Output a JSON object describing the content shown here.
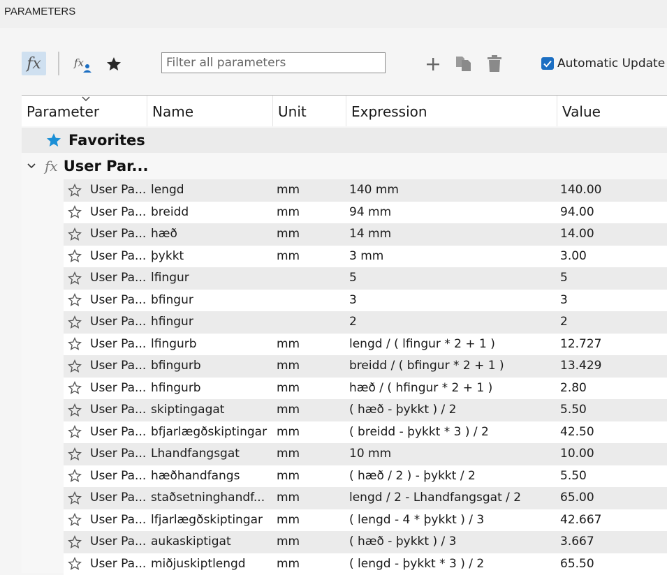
{
  "window": {
    "title": "PARAMETERS"
  },
  "toolbar": {
    "fx_label": "fx",
    "fx_user_label": "fx",
    "filter_placeholder": "Filter all parameters",
    "automatic_update_label": "Automatic Update",
    "automatic_update_checked": true
  },
  "columns": [
    "Parameter",
    "Name",
    "Unit",
    "Expression",
    "Value"
  ],
  "groups": {
    "favorites": {
      "label": "Favorites"
    },
    "user": {
      "label": "User Par...",
      "icon_label": "fx"
    }
  },
  "rows": [
    {
      "param": "User Pa...",
      "name": "lengd",
      "unit": "mm",
      "expression": "140 mm",
      "value": "140.00"
    },
    {
      "param": "User Pa...",
      "name": "breidd",
      "unit": "mm",
      "expression": "94 mm",
      "value": "94.00"
    },
    {
      "param": "User Pa...",
      "name": "hæð",
      "unit": "mm",
      "expression": "14 mm",
      "value": "14.00"
    },
    {
      "param": "User Pa...",
      "name": "þykkt",
      "unit": "mm",
      "expression": "3 mm",
      "value": "3.00"
    },
    {
      "param": "User Pa...",
      "name": "lfingur",
      "unit": "",
      "expression": "5",
      "value": "5"
    },
    {
      "param": "User Pa...",
      "name": "bfingur",
      "unit": "",
      "expression": "3",
      "value": "3"
    },
    {
      "param": "User Pa...",
      "name": "hfingur",
      "unit": "",
      "expression": "2",
      "value": "2"
    },
    {
      "param": "User Pa...",
      "name": "lfingurb",
      "unit": "mm",
      "expression": "lengd / ( lfingur * 2 + 1 )",
      "value": "12.727"
    },
    {
      "param": "User Pa...",
      "name": "bfingurb",
      "unit": "mm",
      "expression": "breidd / ( bfingur * 2 + 1 )",
      "value": "13.429"
    },
    {
      "param": "User Pa...",
      "name": "hfingurb",
      "unit": "mm",
      "expression": "hæð / ( hfingur * 2 + 1 )",
      "value": "2.80"
    },
    {
      "param": "User Pa...",
      "name": "skiptingagat",
      "unit": "mm",
      "expression": "( hæð - þykkt ) / 2",
      "value": "5.50"
    },
    {
      "param": "User Pa...",
      "name": "bfjarlægðskiptingar",
      "unit": "mm",
      "expression": "( breidd - þykkt * 3 ) / 2",
      "value": "42.50"
    },
    {
      "param": "User Pa...",
      "name": "Lhandfangsgat",
      "unit": "mm",
      "expression": "10 mm",
      "value": "10.00"
    },
    {
      "param": "User Pa...",
      "name": "hæðhandfangs",
      "unit": "mm",
      "expression": "( hæð / 2 ) - þykkt / 2",
      "value": "5.50"
    },
    {
      "param": "User Pa...",
      "name": "staðsetninghandf...",
      "unit": "mm",
      "expression": "lengd / 2 - Lhandfangsgat / 2",
      "value": "65.00"
    },
    {
      "param": "User Pa...",
      "name": "lfjarlægðskiptingar",
      "unit": "mm",
      "expression": "( lengd - 4 * þykkt ) / 3",
      "value": "42.667"
    },
    {
      "param": "User Pa...",
      "name": "aukaskiptigat",
      "unit": "mm",
      "expression": "( hæð - þykkt ) / 3",
      "value": "3.667"
    },
    {
      "param": "User Pa...",
      "name": "miðjuskiptlengd",
      "unit": "mm",
      "expression": "( lengd - þykkt * 3 ) / 2",
      "value": "65.50"
    }
  ],
  "colors": {
    "accent": "#1b6ec2",
    "favorite_star": "#1b8fd6",
    "row_alt": "#ebebeb",
    "selected_tool": "#cfe0f0"
  }
}
